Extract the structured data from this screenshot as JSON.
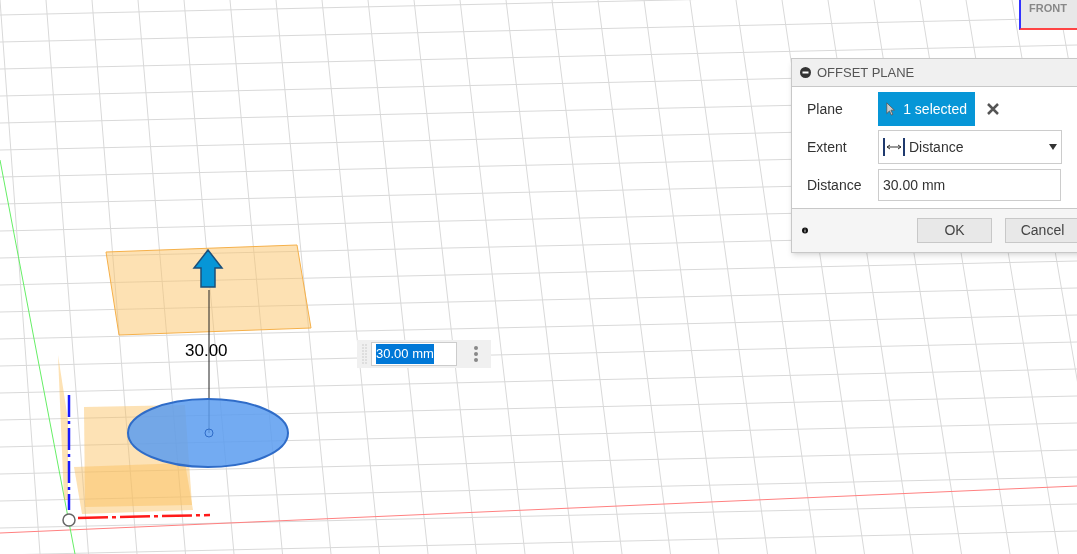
{
  "viewcube": {
    "face": "FRONT"
  },
  "dimension": {
    "label": "30.00"
  },
  "value_input": {
    "value": "30.00 mm",
    "selected": true
  },
  "dialog": {
    "title": "OFFSET PLANE",
    "rows": [
      {
        "kind": "selection",
        "label": "Plane",
        "value": "1 selected"
      },
      {
        "kind": "dropdown",
        "label": "Extent",
        "value": "Distance"
      },
      {
        "kind": "input",
        "label": "Distance",
        "value": "30.00 mm"
      }
    ],
    "buttons": [
      "OK",
      "Cancel"
    ]
  }
}
